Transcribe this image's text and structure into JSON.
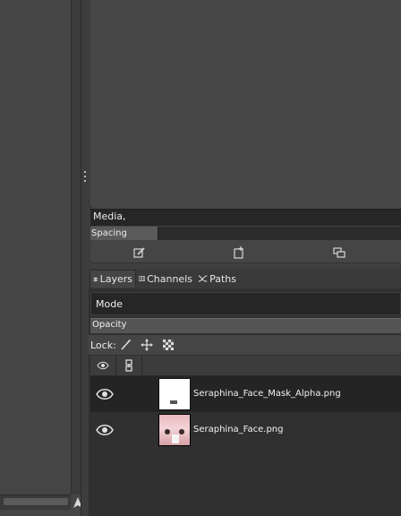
{
  "brushes": {
    "media_label": "Media,",
    "spacing_label": "Spacing",
    "spacing_level": 0.22
  },
  "tabs": [
    {
      "label": "Layers",
      "icon": "layers-icon"
    },
    {
      "label": "Channels",
      "icon": "channels-icon"
    },
    {
      "label": "Paths",
      "icon": "paths-icon"
    }
  ],
  "layers_panel": {
    "mode_label": "Mode",
    "opacity_label": "Opacity",
    "lock_label": "Lock:",
    "layers": [
      {
        "name": "Seraphina_Face_Mask_Alpha.png",
        "visible": true,
        "selected": true
      },
      {
        "name": "Seraphina_Face.png",
        "visible": true,
        "selected": false
      }
    ]
  },
  "colors": {
    "panel_bg": "#454545",
    "selected_row": "#242424",
    "field_bg": "#262626"
  }
}
